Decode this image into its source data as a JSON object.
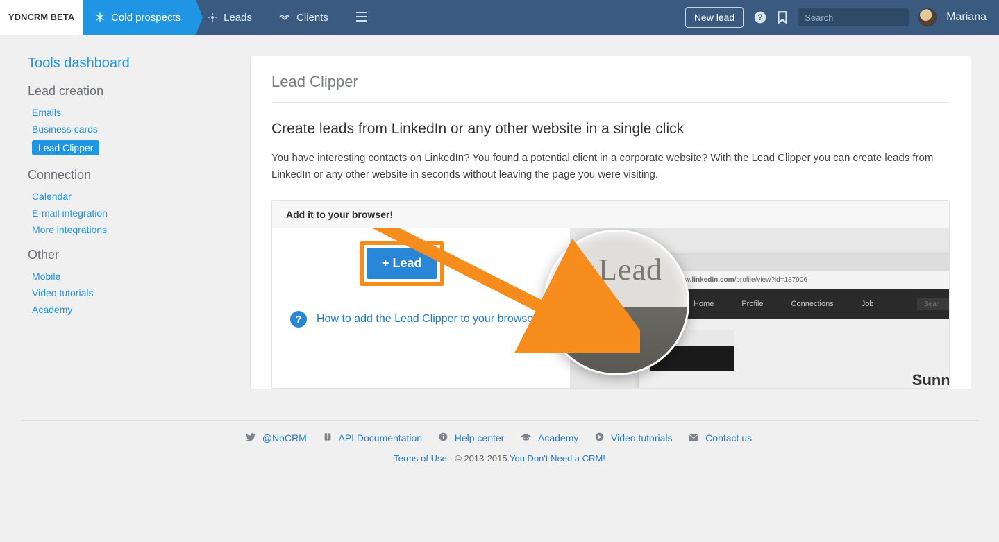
{
  "brand": "YDNCRM BETA",
  "nav": {
    "tabs": [
      {
        "label": "Cold prospects",
        "icon": "snowflake"
      },
      {
        "label": "Leads",
        "icon": "target"
      },
      {
        "label": "Clients",
        "icon": "handshake"
      }
    ],
    "newLead": "New lead",
    "searchPlaceholder": "Search",
    "user": "Mariana"
  },
  "sidebar": {
    "dashboard": "Tools dashboard",
    "sections": [
      {
        "title": "Lead creation",
        "items": [
          {
            "label": "Emails"
          },
          {
            "label": "Business cards"
          },
          {
            "label": "Lead Clipper",
            "active": true
          }
        ]
      },
      {
        "title": "Connection",
        "items": [
          {
            "label": "Calendar"
          },
          {
            "label": "E-mail integration"
          },
          {
            "label": "More integrations"
          }
        ]
      },
      {
        "title": "Other",
        "items": [
          {
            "label": "Mobile"
          },
          {
            "label": "Video tutorials"
          },
          {
            "label": "Academy"
          }
        ]
      }
    ]
  },
  "card": {
    "title": "Lead Clipper",
    "headline": "Create leads from LinkedIn or any other website in a single click",
    "desc": "You have interesting contacts on LinkedIn? You found a potential client in a corporate website? With the Lead Clipper you can create leads from LinkedIn or any other website in seconds without leaving the page you were visiting.",
    "panelTitle": "Add it to your browser!",
    "leadBtn": "+ Lead",
    "magText": "Lead",
    "help": "How to add the Lead Clipper to your browser?",
    "url": "www.linkedin.com",
    "urlPath": "/profile/view?id=187906",
    "liNav": [
      "Home",
      "Profile",
      "Connections",
      "Job"
    ],
    "liSearch": "Sear",
    "liName": "Sunny"
  },
  "footer": {
    "links": [
      {
        "label": "@NoCRM",
        "icon": "twitter"
      },
      {
        "label": "API Documentation",
        "icon": "book"
      },
      {
        "label": "Help center",
        "icon": "info"
      },
      {
        "label": "Academy",
        "icon": "cap"
      },
      {
        "label": "Video tutorials",
        "icon": "play"
      },
      {
        "label": "Contact us",
        "icon": "mail"
      }
    ],
    "tou": "Terms of Use",
    "copy": " - © 2013-2015 ",
    "crm": "You Don't Need a CRM!"
  }
}
